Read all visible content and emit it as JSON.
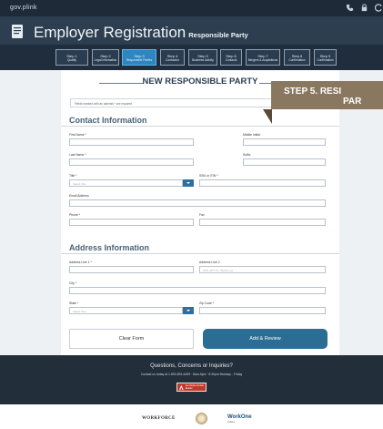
{
  "app": {
    "logo": "gov.plink"
  },
  "header": {
    "title": "Employer Registration",
    "subtitle": "Responsible Party"
  },
  "steps": [
    {
      "num": "Step 1",
      "label": "Qualify"
    },
    {
      "num": "Step 2",
      "label": "Legal Information"
    },
    {
      "num": "Step 3",
      "label": "Responsible Parties"
    },
    {
      "num": "Step 4",
      "label": "Contractor"
    },
    {
      "num": "Step 5",
      "label": "Business Activity"
    },
    {
      "num": "Step 6",
      "label": "Contacts"
    },
    {
      "num": "Step 7",
      "label": "Mergers & Acquisitions"
    },
    {
      "num": "Step 8",
      "label": "Confirmation"
    },
    {
      "num": "Step 9",
      "label": "Confirmation"
    }
  ],
  "active_step": 3,
  "page": {
    "title": "NEW RESPONSIBLE PARTY",
    "required_note": "Fields marked with an asterisk * are required"
  },
  "contact": {
    "heading": "Contact Information",
    "first_name_label": "First Name *",
    "middle_initial_label": "Middle Initial",
    "last_name_label": "Last Name *",
    "suffix_label": "Suffix",
    "title_label": "Title *",
    "title_value": "Select One",
    "ssn_label": "SSN or ITIN *",
    "email_label": "Email Address",
    "phone_label": "Phone *",
    "fax_label": "Fax"
  },
  "address": {
    "heading": "Address Information",
    "line1_label": "Address Line 1 *",
    "line2_label": "Address Line 2",
    "line2_placeholder": "STE, APT, FL, BLDG, etc",
    "city_label": "City *",
    "state_label": "State *",
    "state_value": "Select One",
    "zip_label": "Zip Code *"
  },
  "buttons": {
    "clear": "Clear Form",
    "review": "Add & Review"
  },
  "footer": {
    "question": "Questions, Concerns or Inquiries?",
    "contact": "Contact us today at 1-800-891-6499 · 8am-5pm · 8:30pm Monday - Friday",
    "badge": "Get Adobe Acrobat Reader"
  },
  "logos": {
    "workforce": "WORKFORCE",
    "workone": "WorkOne",
    "workone_sub": "Indiana"
  },
  "banner": {
    "line1": "STEP 5. RESI",
    "line2": "PAR"
  },
  "colors": {
    "accent": "#2e86c1",
    "header": "#2c3e50",
    "button": "#2c6d93",
    "banner": "#8a7760"
  }
}
